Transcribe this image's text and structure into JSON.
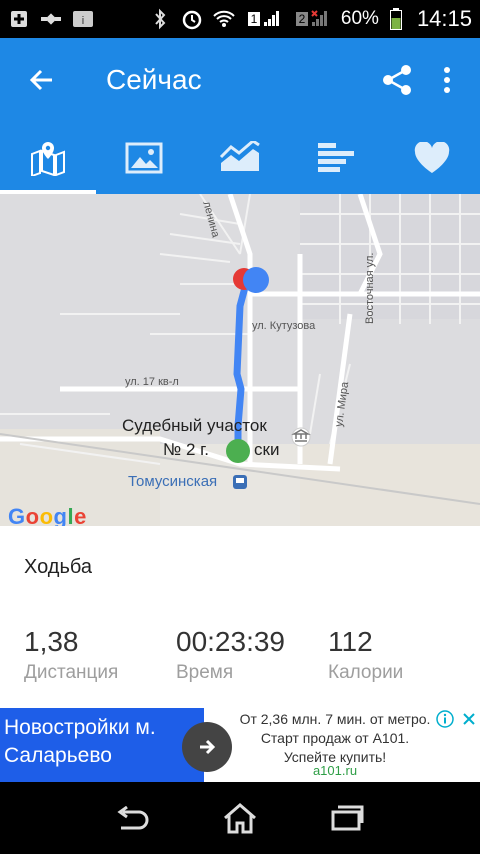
{
  "status_bar": {
    "sim1": "1",
    "sim2": "2",
    "battery": "60%",
    "time": "14:15"
  },
  "app_bar": {
    "title": "Сейчас"
  },
  "tabs": [
    {
      "icon": "map-icon",
      "active": true
    },
    {
      "icon": "image-icon",
      "active": false
    },
    {
      "icon": "chart-icon",
      "active": false
    },
    {
      "icon": "bar-list-icon",
      "active": false
    },
    {
      "icon": "heart-icon",
      "active": false
    }
  ],
  "map": {
    "street_lenina": "ленина",
    "street_vostochnaya": "Восточная ул.",
    "street_kutuzova": "ул. Кутузова",
    "street_17kvl": "ул. 17 кв-л",
    "street_mira": "ул. Мира",
    "poi_line1": "Судебный участок",
    "poi_line2_a": "№ 2 г.",
    "poi_line2_b": "ски",
    "station": "Томусинская",
    "logo": "Google",
    "route_color": "#4285f4",
    "start_color": "#4caf50",
    "end_color": "#e53935"
  },
  "summary": {
    "activity": "Ходьба",
    "distance_value": "1,38",
    "distance_label": "Дистанция",
    "time_value": "00:23:39",
    "time_label": "Время",
    "calories_value": "112",
    "calories_label": "Калории"
  },
  "ad": {
    "headline_line1": "Новостройки м.",
    "headline_line2": "Саларьево",
    "body": "От 2,36 млн. 7 мин. от метро. Старт продаж от А101. Успейте купить!",
    "domain": "a101.ru"
  },
  "colors": {
    "primary": "#1e88e5",
    "ad_blue": "#1e5ee8"
  }
}
